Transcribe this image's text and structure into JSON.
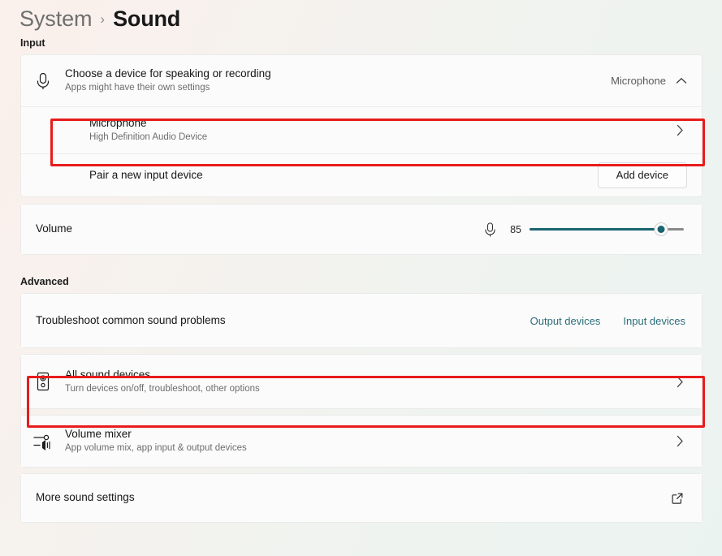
{
  "breadcrumb": {
    "parent": "System",
    "separator": "›",
    "current": "Sound"
  },
  "sections": {
    "input_label": "Input",
    "advanced_label": "Advanced"
  },
  "input": {
    "choose_device": {
      "title": "Choose a device for speaking or recording",
      "subtitle": "Apps might have their own settings",
      "icon": "microphone-icon",
      "selected_value": "Microphone",
      "caret": "chevron-up-icon"
    },
    "device": {
      "title": "Microphone",
      "subtitle": "High Definition Audio Device",
      "chevron": "chevron-right-icon",
      "highlighted": true
    },
    "pair_new": {
      "title": "Pair a new input device",
      "button_label": "Add device"
    },
    "volume": {
      "label": "Volume",
      "icon": "microphone-icon",
      "value": "85",
      "percent": 85,
      "fill_color": "#1a6470",
      "track_color": "#8a8a8a"
    }
  },
  "advanced": {
    "troubleshoot": {
      "title": "Troubleshoot common sound problems",
      "link_output": "Output devices",
      "link_input": "Input devices",
      "link_color": "#2a6d78"
    },
    "all_sound_devices": {
      "title": "All sound devices",
      "subtitle": "Turn devices on/off, troubleshoot, other options",
      "icon": "speaker-device-icon",
      "chevron": "chevron-right-icon",
      "highlighted": true
    },
    "volume_mixer": {
      "title": "Volume mixer",
      "subtitle": "App volume mix, app input & output devices",
      "icon": "volume-mixer-icon",
      "chevron": "chevron-right-icon"
    },
    "more_sound_settings": {
      "title": "More sound settings",
      "icon": "external-link-icon"
    }
  },
  "annotation": {
    "color": "#e81c1c"
  }
}
